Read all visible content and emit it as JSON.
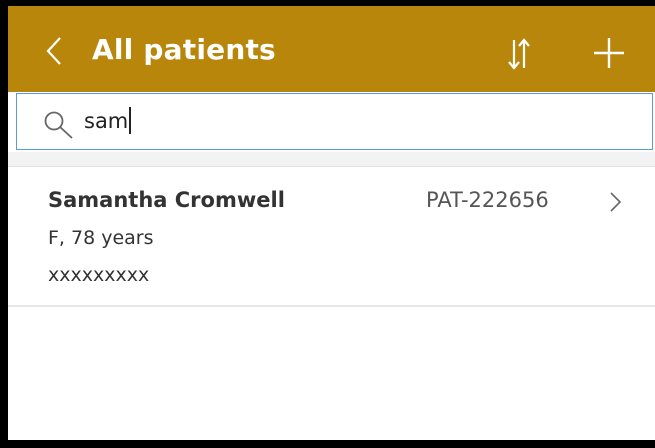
{
  "header": {
    "title": "All patients",
    "back_icon": "chevron-left-icon",
    "sort_icon": "sort-arrows-icon",
    "add_icon": "plus-icon"
  },
  "search": {
    "value": "sam",
    "icon": "search-icon"
  },
  "patients": [
    {
      "name": "Samantha Cromwell",
      "id": "PAT-222656",
      "details": "F, 78 years",
      "extra": "xxxxxxxxx"
    }
  ],
  "colors": {
    "header_background": "#b8860b",
    "header_text": "#ffffff",
    "search_border": "#5b9bd5",
    "divider": "#e6e6e6"
  }
}
